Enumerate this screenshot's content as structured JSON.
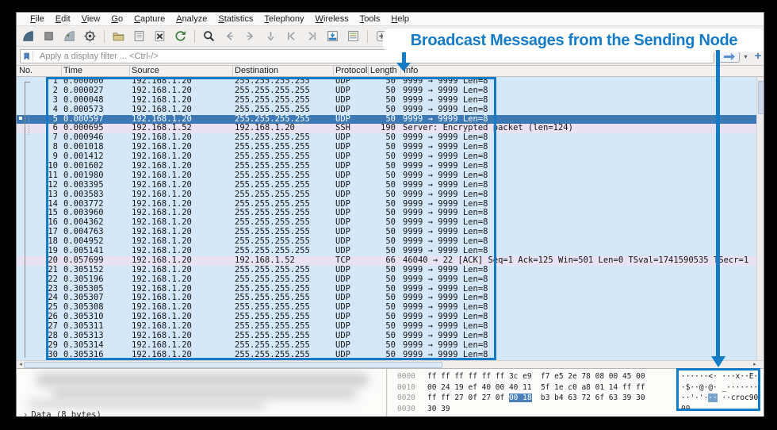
{
  "annotation": {
    "callout": "Broadcast Messages from the Sending Node"
  },
  "menu": {
    "items": [
      "File",
      "Edit",
      "View",
      "Go",
      "Capture",
      "Analyze",
      "Statistics",
      "Telephony",
      "Wireless",
      "Tools",
      "Help"
    ]
  },
  "toolbar": {
    "icons": [
      "start-capture",
      "stop-capture",
      "restart-capture",
      "capture-options",
      "separator",
      "open-file",
      "save-file",
      "close-file",
      "reload-file",
      "separator",
      "find-packet",
      "go-back",
      "go-forward",
      "go-to-packet",
      "first-packet",
      "last-packet",
      "auto-scroll",
      "colorize",
      "separator",
      "zoom-in",
      "zoom-out",
      "zoom-original",
      "resize-columns"
    ]
  },
  "filter": {
    "placeholder": "Apply a display filter ... <Ctrl-/>"
  },
  "packet_list": {
    "columns": [
      "No.",
      "Time",
      "Source",
      "Destination",
      "Protocol",
      "Length",
      "Info"
    ],
    "selected_no": "5",
    "rows": [
      {
        "no": "1",
        "time": "0.000000",
        "src": "192.168.1.20",
        "dst": "255.255.255.255",
        "proto": "UDP",
        "len": "50",
        "info": "9999 → 9999 Len=8"
      },
      {
        "no": "2",
        "time": "0.000027",
        "src": "192.168.1.20",
        "dst": "255.255.255.255",
        "proto": "UDP",
        "len": "50",
        "info": "9999 → 9999 Len=8"
      },
      {
        "no": "3",
        "time": "0.000048",
        "src": "192.168.1.20",
        "dst": "255.255.255.255",
        "proto": "UDP",
        "len": "50",
        "info": "9999 → 9999 Len=8"
      },
      {
        "no": "4",
        "time": "0.000573",
        "src": "192.168.1.20",
        "dst": "255.255.255.255",
        "proto": "UDP",
        "len": "50",
        "info": "9999 → 9999 Len=8"
      },
      {
        "no": "5",
        "time": "0.000597",
        "src": "192.168.1.20",
        "dst": "255.255.255.255",
        "proto": "UDP",
        "len": "50",
        "info": "9999 → 9999 Len=8"
      },
      {
        "no": "6",
        "time": "0.000695",
        "src": "192.168.1.52",
        "dst": "192.168.1.20",
        "proto": "SSH",
        "len": "190",
        "info": "Server: Encrypted packet (len=124)"
      },
      {
        "no": "7",
        "time": "0.000946",
        "src": "192.168.1.20",
        "dst": "255.255.255.255",
        "proto": "UDP",
        "len": "50",
        "info": "9999 → 9999 Len=8"
      },
      {
        "no": "8",
        "time": "0.001018",
        "src": "192.168.1.20",
        "dst": "255.255.255.255",
        "proto": "UDP",
        "len": "50",
        "info": "9999 → 9999 Len=8"
      },
      {
        "no": "9",
        "time": "0.001412",
        "src": "192.168.1.20",
        "dst": "255.255.255.255",
        "proto": "UDP",
        "len": "50",
        "info": "9999 → 9999 Len=8"
      },
      {
        "no": "10",
        "time": "0.001602",
        "src": "192.168.1.20",
        "dst": "255.255.255.255",
        "proto": "UDP",
        "len": "50",
        "info": "9999 → 9999 Len=8"
      },
      {
        "no": "11",
        "time": "0.001980",
        "src": "192.168.1.20",
        "dst": "255.255.255.255",
        "proto": "UDP",
        "len": "50",
        "info": "9999 → 9999 Len=8"
      },
      {
        "no": "12",
        "time": "0.003395",
        "src": "192.168.1.20",
        "dst": "255.255.255.255",
        "proto": "UDP",
        "len": "50",
        "info": "9999 → 9999 Len=8"
      },
      {
        "no": "13",
        "time": "0.003583",
        "src": "192.168.1.20",
        "dst": "255.255.255.255",
        "proto": "UDP",
        "len": "50",
        "info": "9999 → 9999 Len=8"
      },
      {
        "no": "14",
        "time": "0.003772",
        "src": "192.168.1.20",
        "dst": "255.255.255.255",
        "proto": "UDP",
        "len": "50",
        "info": "9999 → 9999 Len=8"
      },
      {
        "no": "15",
        "time": "0.003960",
        "src": "192.168.1.20",
        "dst": "255.255.255.255",
        "proto": "UDP",
        "len": "50",
        "info": "9999 → 9999 Len=8"
      },
      {
        "no": "16",
        "time": "0.004362",
        "src": "192.168.1.20",
        "dst": "255.255.255.255",
        "proto": "UDP",
        "len": "50",
        "info": "9999 → 9999 Len=8"
      },
      {
        "no": "17",
        "time": "0.004763",
        "src": "192.168.1.20",
        "dst": "255.255.255.255",
        "proto": "UDP",
        "len": "50",
        "info": "9999 → 9999 Len=8"
      },
      {
        "no": "18",
        "time": "0.004952",
        "src": "192.168.1.20",
        "dst": "255.255.255.255",
        "proto": "UDP",
        "len": "50",
        "info": "9999 → 9999 Len=8"
      },
      {
        "no": "19",
        "time": "0.005141",
        "src": "192.168.1.20",
        "dst": "255.255.255.255",
        "proto": "UDP",
        "len": "50",
        "info": "9999 → 9999 Len=8"
      },
      {
        "no": "20",
        "time": "0.057699",
        "src": "192.168.1.20",
        "dst": "192.168.1.52",
        "proto": "TCP",
        "len": "66",
        "info": "46040 → 22 [ACK] Seq=1 Ack=125 Win=501 Len=0 TSval=1741590535 TSecr=1"
      },
      {
        "no": "21",
        "time": "0.305152",
        "src": "192.168.1.20",
        "dst": "255.255.255.255",
        "proto": "UDP",
        "len": "50",
        "info": "9999 → 9999 Len=8"
      },
      {
        "no": "22",
        "time": "0.305196",
        "src": "192.168.1.20",
        "dst": "255.255.255.255",
        "proto": "UDP",
        "len": "50",
        "info": "9999 → 9999 Len=8"
      },
      {
        "no": "23",
        "time": "0.305305",
        "src": "192.168.1.20",
        "dst": "255.255.255.255",
        "proto": "UDP",
        "len": "50",
        "info": "9999 → 9999 Len=8"
      },
      {
        "no": "24",
        "time": "0.305307",
        "src": "192.168.1.20",
        "dst": "255.255.255.255",
        "proto": "UDP",
        "len": "50",
        "info": "9999 → 9999 Len=8"
      },
      {
        "no": "25",
        "time": "0.305308",
        "src": "192.168.1.20",
        "dst": "255.255.255.255",
        "proto": "UDP",
        "len": "50",
        "info": "9999 → 9999 Len=8"
      },
      {
        "no": "26",
        "time": "0.305310",
        "src": "192.168.1.20",
        "dst": "255.255.255.255",
        "proto": "UDP",
        "len": "50",
        "info": "9999 → 9999 Len=8"
      },
      {
        "no": "27",
        "time": "0.305311",
        "src": "192.168.1.20",
        "dst": "255.255.255.255",
        "proto": "UDP",
        "len": "50",
        "info": "9999 → 9999 Len=8"
      },
      {
        "no": "28",
        "time": "0.305313",
        "src": "192.168.1.20",
        "dst": "255.255.255.255",
        "proto": "UDP",
        "len": "50",
        "info": "9999 → 9999 Len=8"
      },
      {
        "no": "29",
        "time": "0.305314",
        "src": "192.168.1.20",
        "dst": "255.255.255.255",
        "proto": "UDP",
        "len": "50",
        "info": "9999 → 9999 Len=8"
      },
      {
        "no": "30",
        "time": "0.305316",
        "src": "192.168.1.20",
        "dst": "255.255.255.255",
        "proto": "UDP",
        "len": "50",
        "info": "9999 → 9999 Len=8"
      }
    ]
  },
  "details_pane": {
    "expander": "›",
    "partial_row": "Data (8 bytes)"
  },
  "hex": {
    "rows": [
      {
        "offset": "0000",
        "hex_pre": "ff ff ff ff ff ff 3c e9  f7 e5 2e 78 08 00 45 00",
        "hex_hl": "",
        "hex_post": "",
        "ascii_pre": "······<· ···x··E·",
        "ascii_hl": "",
        "ascii_post": ""
      },
      {
        "offset": "0010",
        "hex_pre": "00 24 19 ef 40 00 40 11  5f 1e c0 a8 01 14 ff ff",
        "hex_hl": "",
        "hex_post": "",
        "ascii_pre": "·$··@·@· _·······",
        "ascii_hl": "",
        "ascii_post": ""
      },
      {
        "offset": "0020",
        "hex_pre": "ff ff 27 0f 27 0f ",
        "hex_hl": "00 18",
        "hex_post": "  b3 b4 63 72 6f 63 39 30",
        "ascii_pre": "··'·'·",
        "ascii_hl": "··",
        "ascii_post": " ··croc90"
      },
      {
        "offset": "0030",
        "hex_pre": "30 39",
        "hex_hl": "",
        "hex_post": "",
        "ascii_pre": "09",
        "ascii_hl": "",
        "ascii_post": ""
      }
    ]
  },
  "colors": {
    "annotation_blue": "#147bc7",
    "row_udp": "#d4e8fa",
    "row_ssh_tcp": "#e8e2f3",
    "row_selected": "#3c79b5",
    "hex_highlight": "#4c80b8"
  }
}
